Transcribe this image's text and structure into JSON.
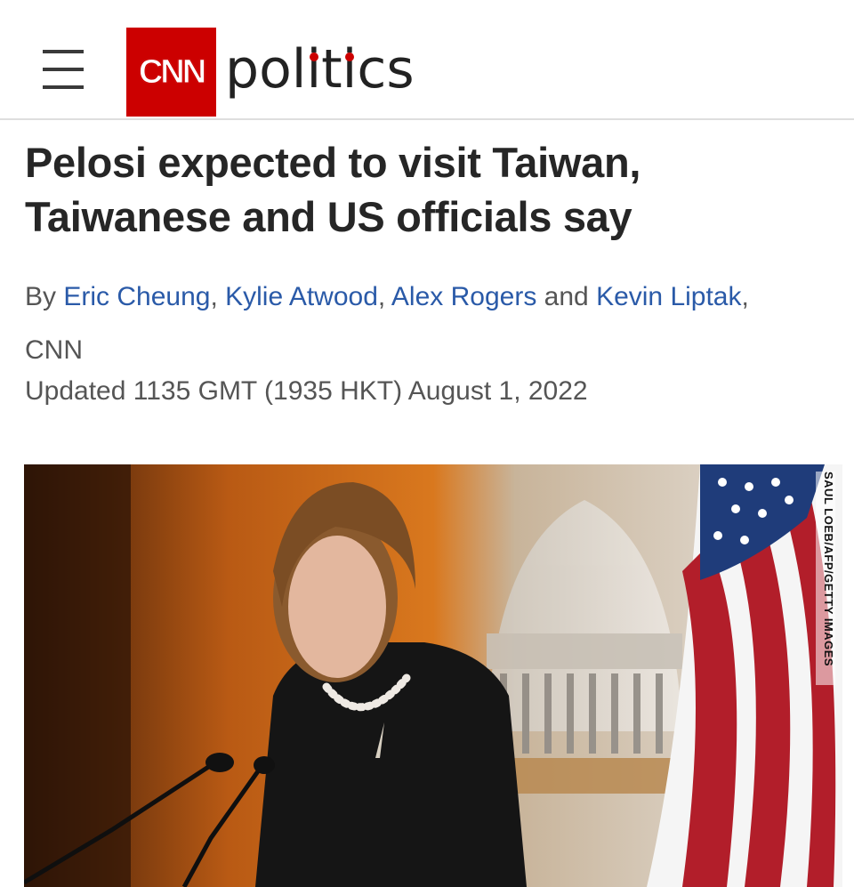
{
  "header": {
    "menu_icon": "hamburger-menu-icon",
    "brand": "CNN",
    "section_parts": [
      "pol",
      "i",
      "t",
      "i",
      "cs"
    ],
    "brand_color": "#cc0000"
  },
  "article": {
    "headline_line1": "Pelosi expected to visit Taiwan,",
    "headline_line2": "Taiwanese and US officials say",
    "byline": {
      "prefix": "By ",
      "authors": [
        "Eric Cheung",
        "Kylie Atwood",
        "Alex Rogers",
        "Kevin Liptak"
      ],
      "sep1": ", ",
      "sep2": ", ",
      "conj": " and ",
      "suffix": ",",
      "outlet": "CNN"
    },
    "updated": "Updated 1135 GMT (1935 HKT) August 1, 2022",
    "link_color": "#2a5aa8"
  },
  "photo": {
    "credit": "SAUL LOEB/AFP/GETTY IMAGES"
  }
}
